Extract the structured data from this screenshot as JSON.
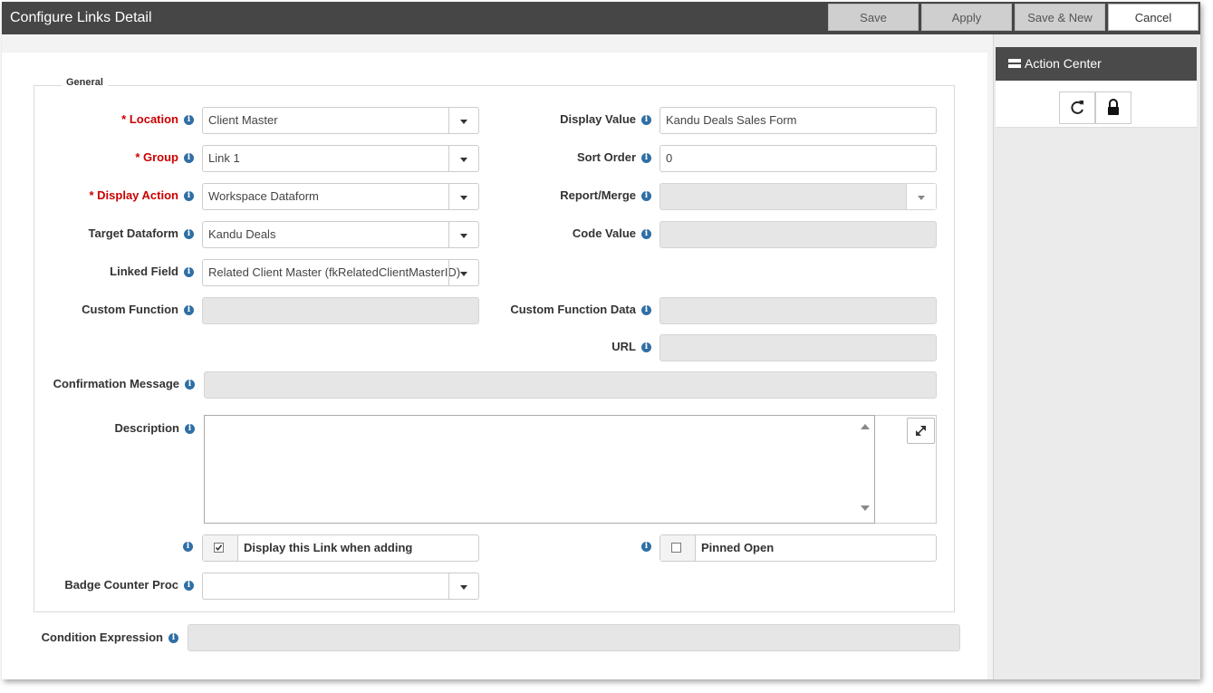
{
  "window": {
    "title": "Configure Links Detail"
  },
  "toolbar": {
    "save": "Save",
    "apply": "Apply",
    "save_new": "Save & New",
    "cancel": "Cancel"
  },
  "action_center": {
    "title": "Action Center",
    "icons": [
      "refresh-icon",
      "lock-icon"
    ]
  },
  "general": {
    "legend": "General",
    "location": {
      "label": "Location",
      "value": "Client Master"
    },
    "group": {
      "label": "Group",
      "value": "Link 1"
    },
    "display_action": {
      "label": "Display Action",
      "value": "Workspace Dataform"
    },
    "target_dataform": {
      "label": "Target Dataform",
      "value": "Kandu Deals"
    },
    "linked_field": {
      "label": "Linked Field",
      "value": "Related Client Master (fkRelatedClientMasterID)"
    },
    "custom_function": {
      "label": "Custom Function",
      "value": ""
    },
    "display_value": {
      "label": "Display Value",
      "value": "Kandu Deals Sales Form"
    },
    "sort_order": {
      "label": "Sort Order",
      "value": "0"
    },
    "report_merge": {
      "label": "Report/Merge",
      "value": ""
    },
    "code_value": {
      "label": "Code Value",
      "value": ""
    },
    "custom_function_data": {
      "label": "Custom Function Data",
      "value": ""
    },
    "url": {
      "label": "URL",
      "value": ""
    },
    "confirmation_message": {
      "label": "Confirmation Message",
      "value": ""
    },
    "description": {
      "label": "Description",
      "value": ""
    },
    "display_when_adding": {
      "label": "Display this Link when adding",
      "checked": true
    },
    "pinned_open": {
      "label": "Pinned Open",
      "checked": false
    },
    "badge_counter_proc": {
      "label": "Badge Counter Proc",
      "value": ""
    }
  },
  "condition_expression": {
    "label": "Condition Expression",
    "value": ""
  },
  "required_marker": "*",
  "colors": {
    "titlebar": "#464646",
    "required": "#cc0000",
    "info": "#2f6fa5"
  }
}
